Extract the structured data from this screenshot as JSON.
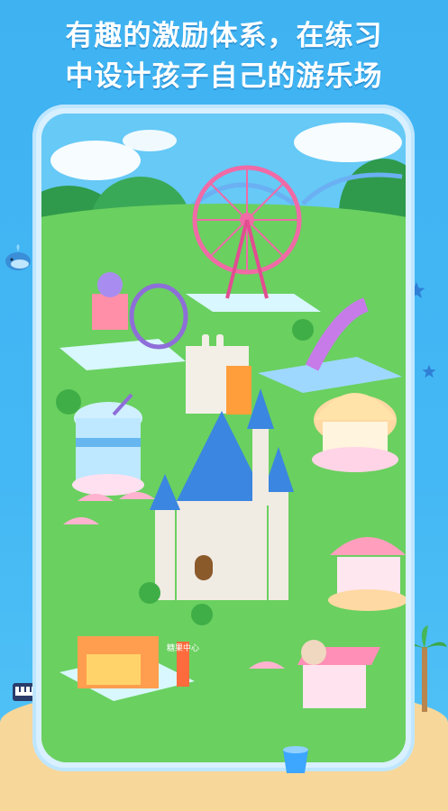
{
  "headline": {
    "line1": "有趣的激励体系，在练习",
    "line2": "中设计孩子自己的游乐场"
  },
  "booth_sign": "糖果中心",
  "colors": {
    "background": "#44b8f4",
    "headline_text": "#ffffff",
    "grass": "#69d05f"
  }
}
